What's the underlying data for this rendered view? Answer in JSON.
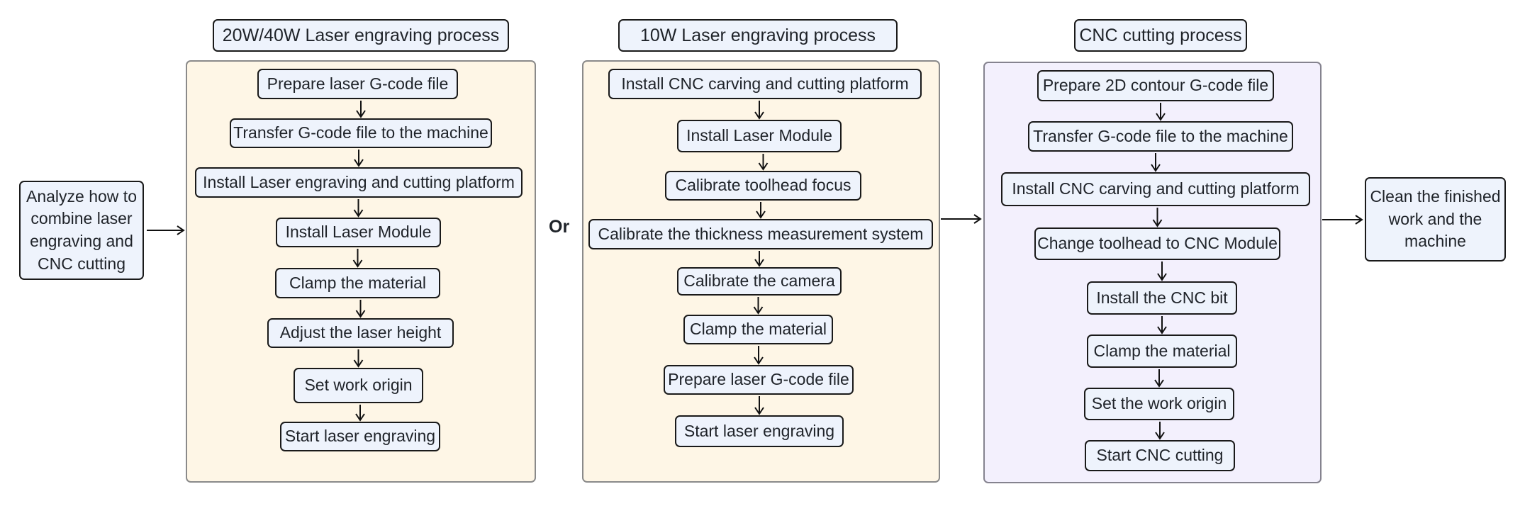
{
  "start_node": {
    "label": "Analyze how to combine laser engraving and CNC cutting"
  },
  "end_node": {
    "label": "Clean the finished work and the machine"
  },
  "separator_label": "Or",
  "processes": [
    {
      "title": "20W/40W Laser engraving process",
      "steps": [
        "Prepare laser G-code file",
        "Transfer G-code file to the machine",
        "Install Laser engraving and cutting platform",
        "Install Laser Module",
        "Clamp the material",
        "Adjust the laser height",
        "Set work origin",
        "Start laser engraving"
      ]
    },
    {
      "title": "10W Laser engraving process",
      "steps": [
        "Install CNC carving and cutting platform",
        "Install Laser Module",
        "Calibrate toolhead focus",
        "Calibrate the thickness measurement system",
        "Calibrate the camera",
        "Clamp the material",
        "Prepare laser G-code file",
        "Start laser engraving"
      ]
    },
    {
      "title": "CNC cutting process",
      "steps": [
        "Prepare 2D contour G-code file",
        "Transfer G-code file to the machine",
        "Install CNC carving and cutting platform",
        "Change toolhead to CNC Module",
        "Install the CNC bit",
        "Clamp the material",
        "Set the work origin",
        "Start CNC cutting"
      ]
    }
  ],
  "colors": {
    "laser_panel_bg": "#fef6e6",
    "cnc_panel_bg": "#f3f0fd",
    "node_bg": "#eef3fc",
    "node_border": "#1a1a1a"
  }
}
